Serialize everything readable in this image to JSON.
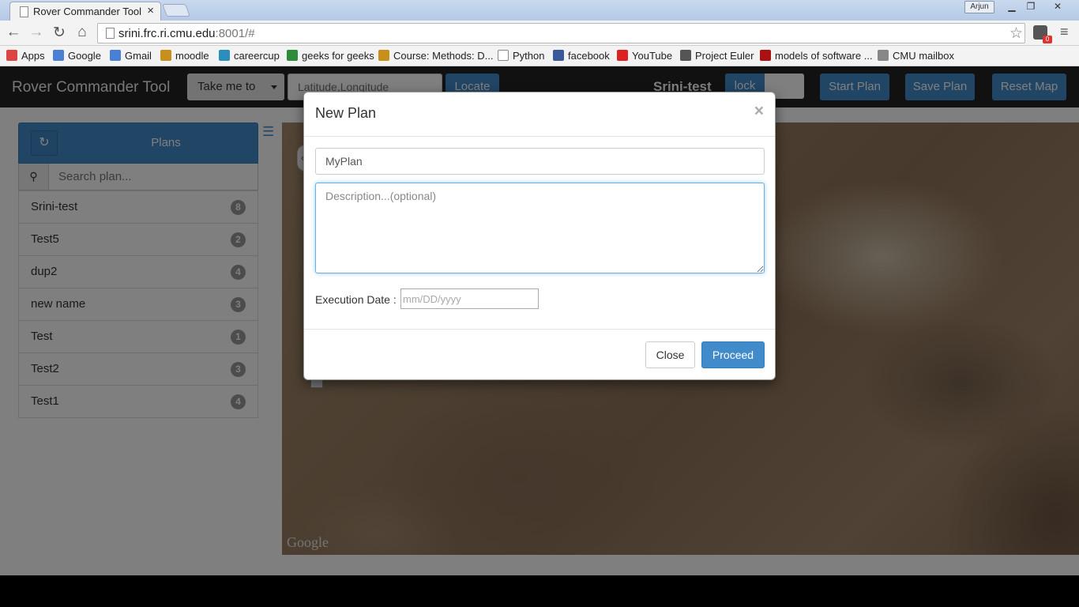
{
  "browser": {
    "tab_title": "Rover Commander Tool",
    "tab_close": "×",
    "user_badge": "Arjun",
    "url_host": "srini.frc.ri.cmu.edu",
    "url_rest": ":8001/#",
    "ext_badge": "0",
    "icons": [
      "back-arrow-icon",
      "forward-arrow-icon",
      "reload-icon",
      "home-icon",
      "star-icon",
      "chrome-menu-icon"
    ]
  },
  "bookmarks": [
    {
      "label": "Apps",
      "color": "#d44"
    },
    {
      "label": "Google",
      "color": "#4a7fd6"
    },
    {
      "label": "Gmail",
      "color": "#4a7fd6"
    },
    {
      "label": "moodle",
      "color": "#c8901a"
    },
    {
      "label": "careercup",
      "color": "#2a8fbd"
    },
    {
      "label": "geeks for geeks",
      "color": "#2e8b3a"
    },
    {
      "label": "Course: Methods: D...",
      "color": "#c8901a"
    },
    {
      "label": "Python",
      "color": "#ffffff"
    },
    {
      "label": "facebook",
      "color": "#3b5998"
    },
    {
      "label": "YouTube",
      "color": "#d22"
    },
    {
      "label": "Project Euler",
      "color": "#555"
    },
    {
      "label": "models of software ...",
      "color": "#a11"
    },
    {
      "label": "CMU mailbox",
      "color": "#888"
    }
  ],
  "navbar": {
    "brand": "Rover Commander Tool",
    "take_me_to": "Take me to",
    "latlng_placeholder": "Latitude,Longitude",
    "locate": "Locate",
    "current_plan": "Srini-test",
    "lock": "lock",
    "start_plan": "Start Plan",
    "save_plan": "Save Plan",
    "reset_map": "Reset Map"
  },
  "sidebar": {
    "title": "Plans",
    "search_placeholder": "Search plan...",
    "plans": [
      {
        "name": "Srini-test",
        "count": "8"
      },
      {
        "name": "Test5",
        "count": "2"
      },
      {
        "name": "dup2",
        "count": "4"
      },
      {
        "name": "new name",
        "count": "3"
      },
      {
        "name": "Test",
        "count": "1"
      },
      {
        "name": "Test2",
        "count": "3"
      },
      {
        "name": "Test1",
        "count": "4"
      }
    ]
  },
  "map": {
    "attribution": "Google"
  },
  "modal": {
    "title": "New Plan",
    "close_x": "×",
    "plan_name_value": "MyPlan",
    "description_placeholder": "Description...(optional)",
    "exec_date_label": "Execution Date :",
    "exec_date_placeholder": "mm/DD/yyyy",
    "close_button": "Close",
    "proceed_button": "Proceed"
  },
  "colors": {
    "primary": "#428bca",
    "navbar": "#222222",
    "badge": "#999999"
  }
}
